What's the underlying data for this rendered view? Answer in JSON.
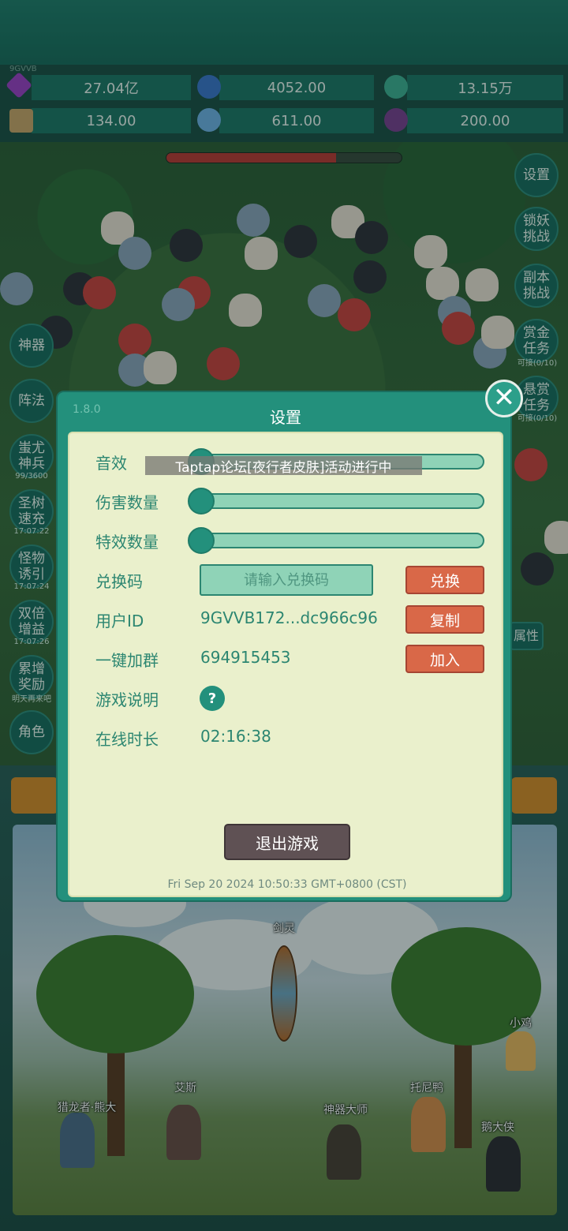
{
  "player_tag": "9GVVB",
  "resources": [
    {
      "icon": "purple-gem-icon",
      "value": "27.04亿"
    },
    {
      "icon": "blue-orb-icon",
      "value": "4052.00"
    },
    {
      "icon": "green-planet-icon",
      "value": "13.15万"
    },
    {
      "icon": "scroll-icon",
      "value": "134.00"
    },
    {
      "icon": "ice-crystal-icon",
      "value": "611.00"
    },
    {
      "icon": "purple-pot-icon",
      "value": "200.00"
    }
  ],
  "boss_hp_fraction": 0.72,
  "right_menu": {
    "settings": "设置",
    "lock_demon": "锁妖\n挑战",
    "dungeon": "副本\n挑战",
    "bounty_gold": "赏金\n任务",
    "bounty_gold_sub": "可接(0/10)",
    "bounty_offer": "悬赏\n任务",
    "bounty_offer_sub": "可接(0/10)",
    "attributes": "属性"
  },
  "left_menu": {
    "artifact": "神器",
    "formation": "阵法",
    "chiyou": "蚩尤\n神兵",
    "chiyou_sub": "99/3600",
    "tree": "圣树\n速充",
    "tree_sub": "17:07:22",
    "lure": "怪物\n诱引",
    "lure_sub": "17:07:24",
    "double": "双倍\n增益",
    "double_sub": "17:07:26",
    "accumulate": "累增\n奖励",
    "accumulate_sub": "明天再来吧",
    "role": "角色"
  },
  "dialog": {
    "version": "1.8.0",
    "title": "设置",
    "toast": "Taptap论坛[夜行者皮肤]活动进行中",
    "sound_label": "音效",
    "sound_level": 0,
    "damage_label": "伤害数量",
    "damage_level": 0,
    "effects_label": "特效数量",
    "effects_level": 0,
    "redeem_label": "兑换码",
    "redeem_placeholder": "请输入兑换码",
    "redeem_button": "兑换",
    "user_id_label": "用户ID",
    "user_id_value": "9GVVB172...dc966c96",
    "copy_button": "复制",
    "group_label": "一键加群",
    "group_value": "694915453",
    "join_button": "加入",
    "guide_label": "游戏说明",
    "guide_button": "?",
    "online_label": "在线时长",
    "online_value": "02:16:38",
    "exit_button": "退出游戏",
    "timestamp": "Fri Sep 20 2024 10:50:33 GMT+0800 (CST)"
  },
  "scene_labels": {
    "sword_spirit": "剑灵",
    "chick": "小鸡",
    "ace": "艾斯",
    "hunter": "猎龙者·熊大",
    "tony": "托尼鸭",
    "master": "神器大师",
    "goose": "鹅大侠"
  }
}
